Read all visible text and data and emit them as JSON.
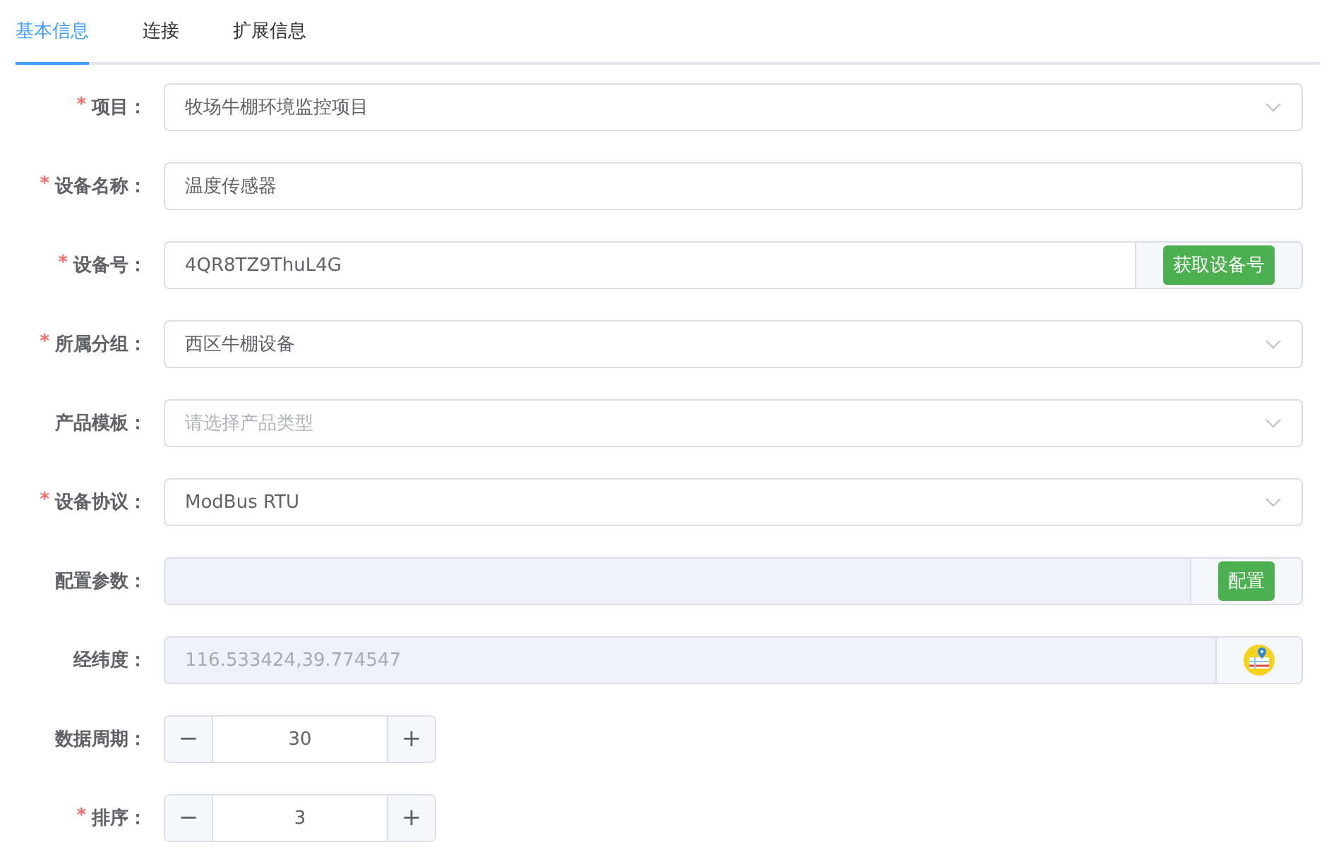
{
  "tabs": [
    {
      "label": "基本信息",
      "selected": true
    },
    {
      "label": "连接",
      "selected": false
    },
    {
      "label": "扩展信息",
      "selected": false
    }
  ],
  "fields": [
    {
      "kind": "select",
      "label": "项目：",
      "marker": "*",
      "value": "牧场牛棚环境监控项目"
    },
    {
      "kind": "text",
      "label": "设备名称：",
      "marker": "*",
      "value": "温度传感器"
    },
    {
      "kind": "text-button",
      "label": "设备号：",
      "marker": "*",
      "value": "4QR8TZ9ThuL4G",
      "button": "获取设备号",
      "disabled": false
    },
    {
      "kind": "select",
      "label": "所属分组：",
      "marker": "*",
      "value": "西区牛棚设备"
    },
    {
      "kind": "select",
      "label": "产品模板：",
      "placeholder": "请选择产品类型"
    },
    {
      "kind": "select",
      "label": "设备协议：",
      "marker": "*",
      "value": "ModBus RTU"
    },
    {
      "kind": "text-button",
      "label": "配置参数：",
      "button": "配置",
      "disabled": true
    },
    {
      "kind": "text-map",
      "label": "经纬度：",
      "value": "116.533424,39.774547",
      "disabled": true
    },
    {
      "kind": "number",
      "label": "数据周期：",
      "value": "30",
      "minus": "−",
      "plus": "+"
    },
    {
      "kind": "number",
      "label": "排序：",
      "marker": "*",
      "value": "3",
      "minus": "−",
      "plus": "+"
    }
  ]
}
